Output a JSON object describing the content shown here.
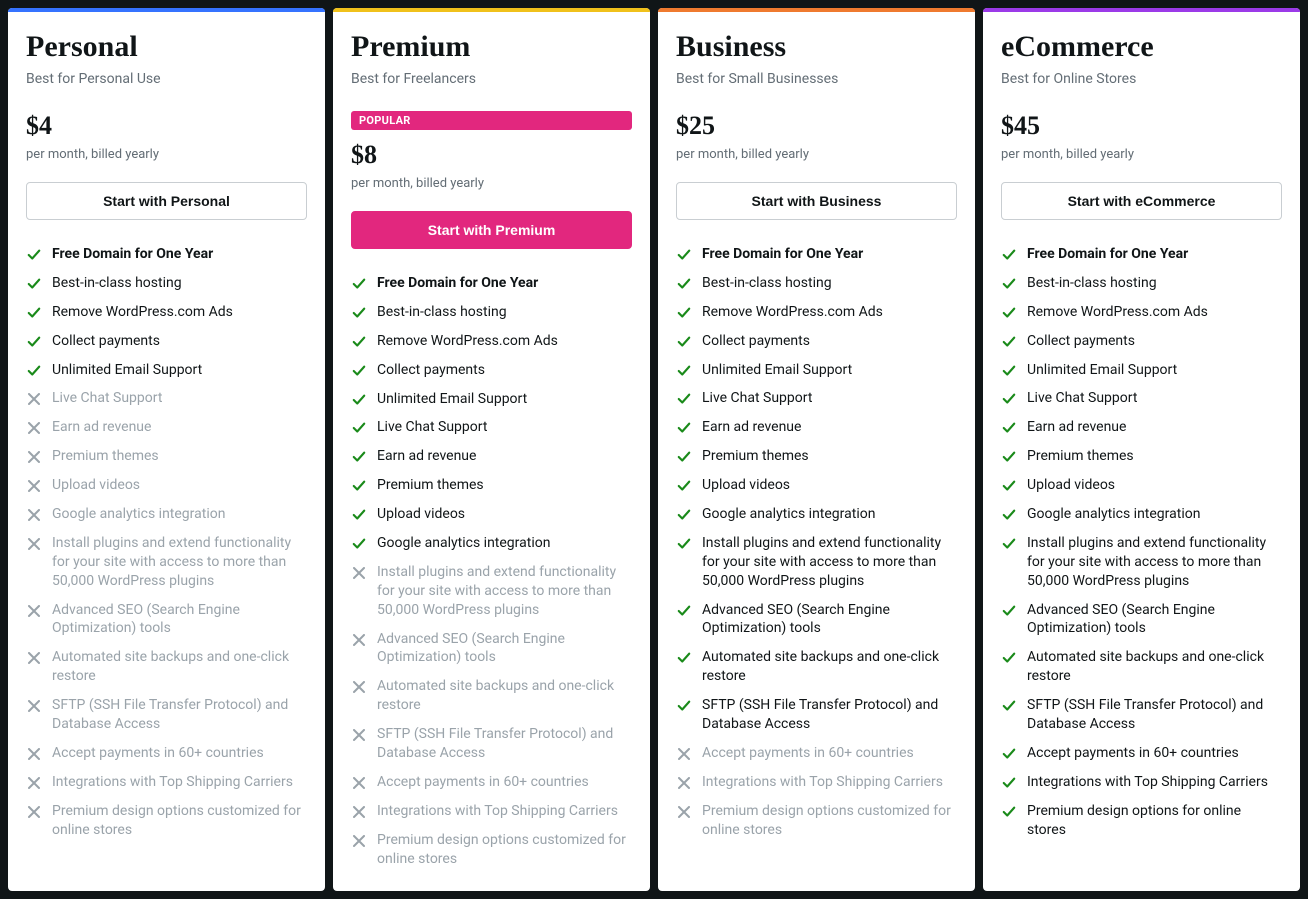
{
  "accents": {
    "personal": "#3573ff",
    "premium": "#f0c11b",
    "business": "#ef7a2f",
    "ecommerce": "#9b3ae8"
  },
  "badge_text": "POPULAR",
  "features": [
    {
      "label": "Free Domain for One Year",
      "bold": true
    },
    {
      "label": "Best-in-class hosting"
    },
    {
      "label": "Remove WordPress.com Ads"
    },
    {
      "label": "Collect payments"
    },
    {
      "label": "Unlimited Email Support"
    },
    {
      "label": "Live Chat Support"
    },
    {
      "label": "Earn ad revenue"
    },
    {
      "label": "Premium themes"
    },
    {
      "label": "Upload videos"
    },
    {
      "label": "Google analytics integration"
    },
    {
      "label": "Install plugins and extend functionality for your site with access to more than 50,000 WordPress plugins"
    },
    {
      "label": "Advanced SEO (Search Engine Optimization) tools"
    },
    {
      "label": "Automated site backups and one-click restore"
    },
    {
      "label": "SFTP (SSH File Transfer Protocol) and Database Access"
    },
    {
      "label": "Accept payments in 60+ countries"
    },
    {
      "label": "Integrations with Top Shipping Carriers"
    },
    {
      "label": "Premium design options customized for online stores",
      "alt_label_ecom": "Premium design options for online stores"
    }
  ],
  "plans": [
    {
      "key": "personal",
      "title": "Personal",
      "subtitle": "Best for Personal Use",
      "price": "$4",
      "billing": "per month, billed yearly",
      "cta": "Start with Personal",
      "highlight": false,
      "included": [
        true,
        true,
        true,
        true,
        true,
        false,
        false,
        false,
        false,
        false,
        false,
        false,
        false,
        false,
        false,
        false,
        false
      ]
    },
    {
      "key": "premium",
      "title": "Premium",
      "subtitle": "Best for Freelancers",
      "price": "$8",
      "billing": "per month, billed yearly",
      "cta": "Start with Premium",
      "highlight": true,
      "included": [
        true,
        true,
        true,
        true,
        true,
        true,
        true,
        true,
        true,
        true,
        false,
        false,
        false,
        false,
        false,
        false,
        false
      ]
    },
    {
      "key": "business",
      "title": "Business",
      "subtitle": "Best for Small Businesses",
      "price": "$25",
      "billing": "per month, billed yearly",
      "cta": "Start with Business",
      "highlight": false,
      "included": [
        true,
        true,
        true,
        true,
        true,
        true,
        true,
        true,
        true,
        true,
        true,
        true,
        true,
        true,
        false,
        false,
        false
      ]
    },
    {
      "key": "ecommerce",
      "title": "eCommerce",
      "subtitle": "Best for Online Stores",
      "price": "$45",
      "billing": "per month, billed yearly",
      "cta": "Start with eCommerce",
      "highlight": false,
      "included": [
        true,
        true,
        true,
        true,
        true,
        true,
        true,
        true,
        true,
        true,
        true,
        true,
        true,
        true,
        true,
        true,
        true
      ]
    }
  ]
}
